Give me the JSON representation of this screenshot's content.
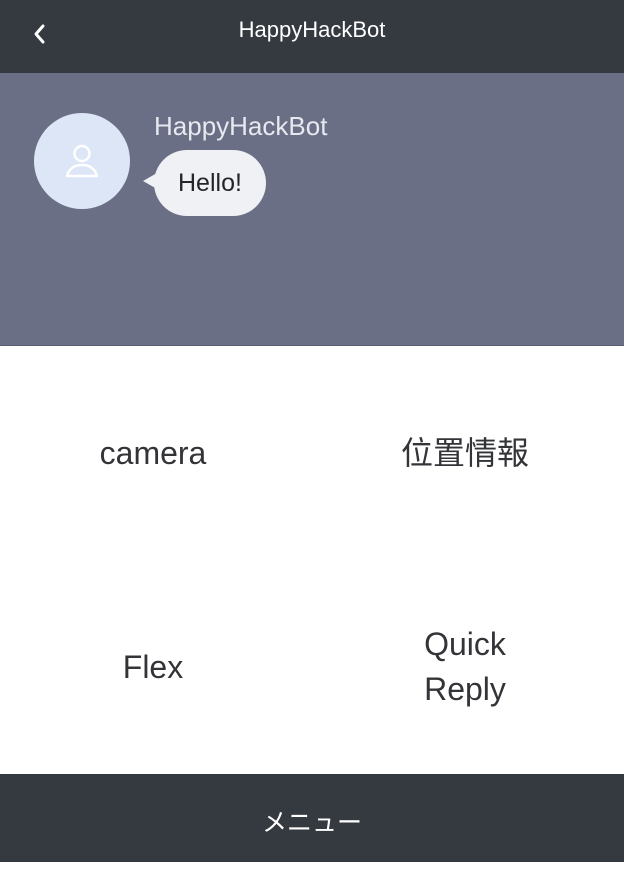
{
  "header": {
    "title": "HappyHackBot",
    "back_icon": "chevron-left-icon"
  },
  "chat": {
    "background_color": "#6a6f85",
    "messages": [
      {
        "sender": "HappyHackBot",
        "avatar_icon": "user-icon",
        "text": "Hello!"
      }
    ]
  },
  "rich_menu": {
    "items": [
      {
        "label": "camera"
      },
      {
        "label": "位置情報"
      },
      {
        "label": "Flex"
      },
      {
        "label": "Quick\nReply"
      }
    ]
  },
  "footer": {
    "label": "メニュー"
  },
  "colors": {
    "header_bg": "#353940",
    "bubble_bg": "#eff1f5",
    "avatar_bg": "#dde6f7"
  }
}
